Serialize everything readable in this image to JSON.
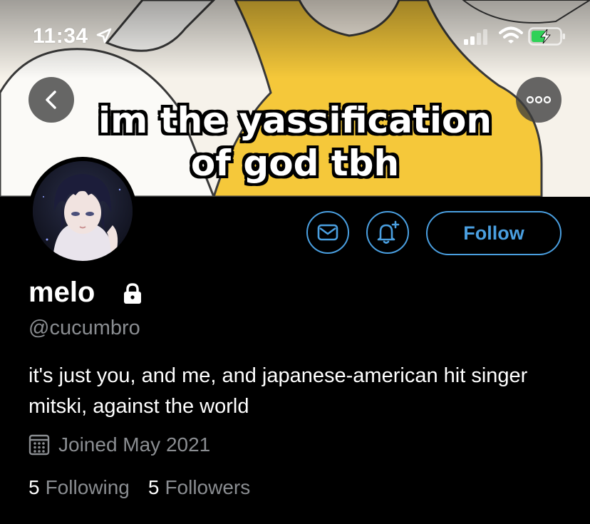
{
  "status_bar": {
    "time": "11:34",
    "location_icon": "location-arrow-icon",
    "signal_icon": "cellular-signal-icon",
    "wifi_icon": "wifi-icon",
    "battery_icon": "battery-charging-icon",
    "battery_color": "#30d158"
  },
  "header": {
    "back_icon": "chevron-left-icon",
    "more_icon": "more-horizontal-icon",
    "banner_caption_line1": "im the yassification",
    "banner_caption_line2": "of god tbh"
  },
  "actions": {
    "message_icon": "envelope-icon",
    "notify_icon": "bell-plus-icon",
    "follow_label": "Follow",
    "accent_color": "#4a9fe0"
  },
  "profile": {
    "display_name": "melo",
    "protected_icon": "lock-icon",
    "handle": "@cucumbro",
    "bio": "it's just you, and me, and japanese-american hit singer mitski, against the world",
    "joined_icon": "calendar-icon",
    "joined": "Joined May 2021",
    "following_count": "5",
    "following_label": "Following",
    "followers_count": "5",
    "followers_label": "Followers"
  }
}
